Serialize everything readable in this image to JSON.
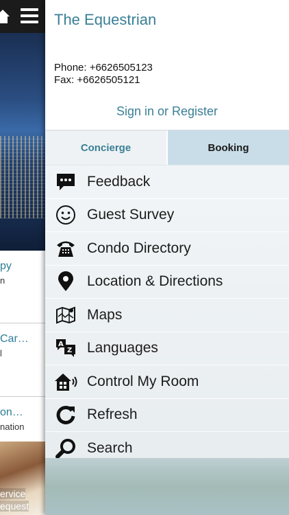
{
  "background_app": {
    "cards": [
      {
        "title": "py",
        "subtitle": "n"
      },
      {
        "title": "Car…",
        "subtitle": "l"
      },
      {
        "title": "on…",
        "subtitle": "nation"
      }
    ],
    "photo_caption_1": "ervice",
    "photo_caption_2": "equest"
  },
  "drawer": {
    "hotel_name": "The Equestrian",
    "phone": "Phone: +6626505123",
    "fax": "Fax: +6626505121",
    "sign_in": "Sign in or Register",
    "tabs": [
      {
        "label": "Concierge",
        "selected": false
      },
      {
        "label": "Booking",
        "selected": true
      }
    ],
    "menu": [
      {
        "label": "Feedback",
        "icon": "feedback-icon"
      },
      {
        "label": "Guest Survey",
        "icon": "smiley-icon"
      },
      {
        "label": "Condo Directory",
        "icon": "telephone-icon"
      },
      {
        "label": "Location & Directions",
        "icon": "location-pin-icon"
      },
      {
        "label": "Maps",
        "icon": "map-icon"
      },
      {
        "label": "Languages",
        "icon": "languages-icon"
      },
      {
        "label": "Control My Room",
        "icon": "smart-home-icon"
      },
      {
        "label": "Refresh",
        "icon": "refresh-icon"
      },
      {
        "label": "Search",
        "icon": "search-icon"
      }
    ]
  },
  "colors": {
    "accent": "#3a7f96",
    "selected_tab": "#c9dde8"
  }
}
